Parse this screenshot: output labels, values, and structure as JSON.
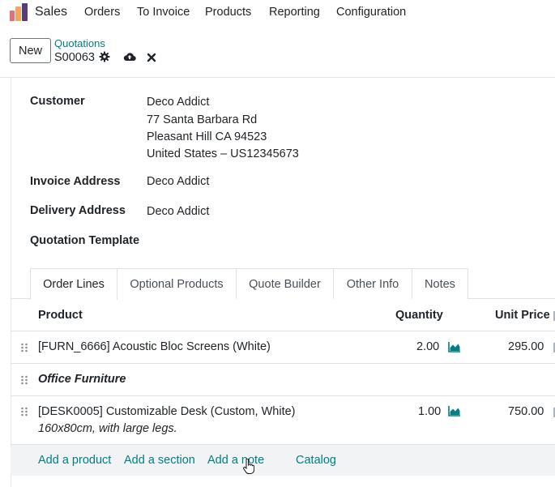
{
  "nav": {
    "app_name": "Sales",
    "menu": [
      "Orders",
      "To Invoice",
      "Products",
      "Reporting",
      "Configuration"
    ]
  },
  "control_panel": {
    "new_label": "New",
    "breadcrumb_parent": "Quotations",
    "record_name": "S00063"
  },
  "form": {
    "customer_label": "Customer",
    "customer_lines": [
      "Deco Addict",
      "77 Santa Barbara Rd",
      "Pleasant Hill CA 94523",
      "United States – US12345673"
    ],
    "invoice_address_label": "Invoice Address",
    "invoice_address": "Deco Addict",
    "delivery_address_label": "Delivery Address",
    "delivery_address": "Deco Addict",
    "quotation_template_label": "Quotation Template"
  },
  "tabs": [
    "Order Lines",
    "Optional Products",
    "Quote Builder",
    "Other Info",
    "Notes"
  ],
  "table": {
    "columns": [
      "Product",
      "Quantity",
      "Unit Price"
    ],
    "rows": [
      {
        "product": "[FURN_6666] Acoustic Bloc Screens (White)",
        "quantity": "2.00",
        "unit_price": "295.00"
      },
      {
        "section": "Office Furniture"
      },
      {
        "product": "[DESK0005] Customizable Desk (Custom, White)",
        "description": "160x80cm, with large legs.",
        "quantity": "1.00",
        "unit_price": "750.00"
      }
    ],
    "add_links": [
      "Add a product",
      "Add a section",
      "Add a note",
      "Catalog"
    ]
  },
  "colors": {
    "accent": "#017e84",
    "text": "#212529"
  },
  "icons": {
    "record_settings": "gear-icon",
    "save": "cloud-upload-icon",
    "discard": "close-icon",
    "forecast": "area-chart-icon",
    "drag": "drag-handle-icon"
  }
}
